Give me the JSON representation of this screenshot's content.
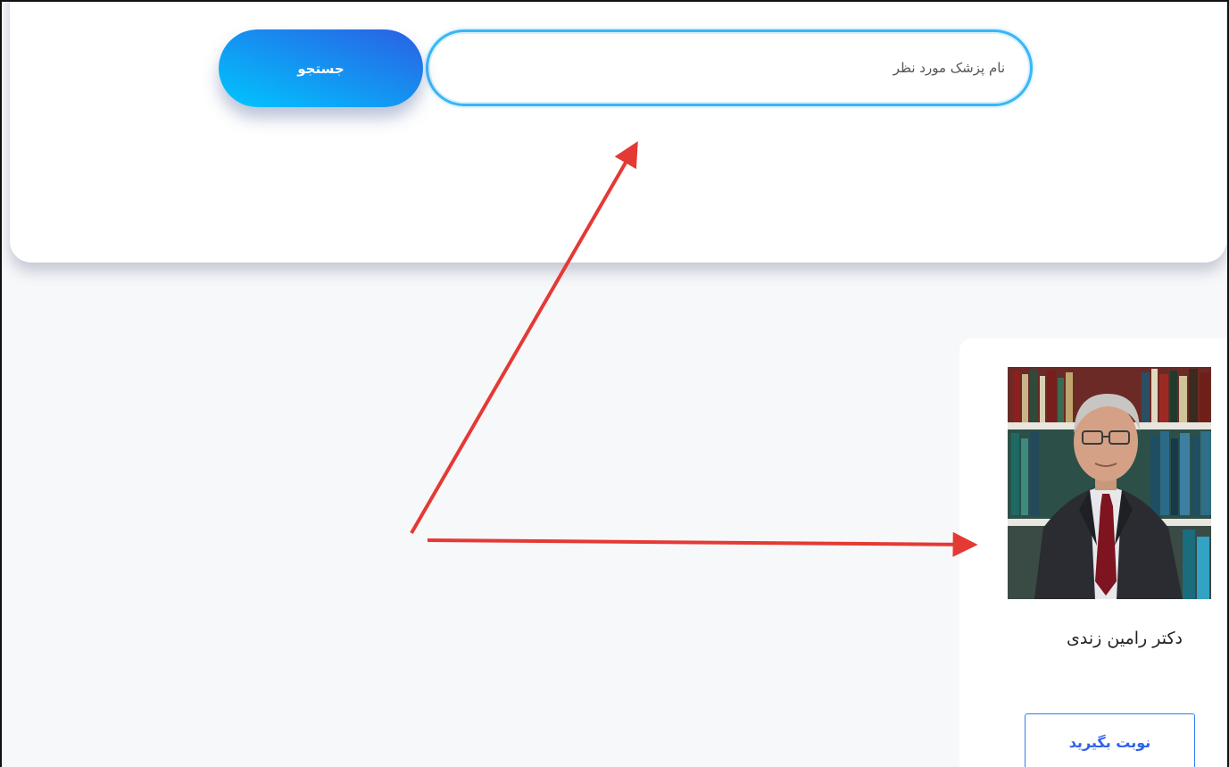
{
  "search": {
    "placeholder": "نام پزشک مورد نظر",
    "value": "",
    "button_label": "جستجو"
  },
  "doctor": {
    "name": "دکتر رامین زندی",
    "book_label": "نوبت بگیرید"
  },
  "annotation": {
    "arrow_color": "#e53935"
  },
  "colors": {
    "accent_start": "#00c6ff",
    "accent_end": "#2a5fe3",
    "input_border": "#39b6f5",
    "page_background": "#f7f8fa"
  }
}
